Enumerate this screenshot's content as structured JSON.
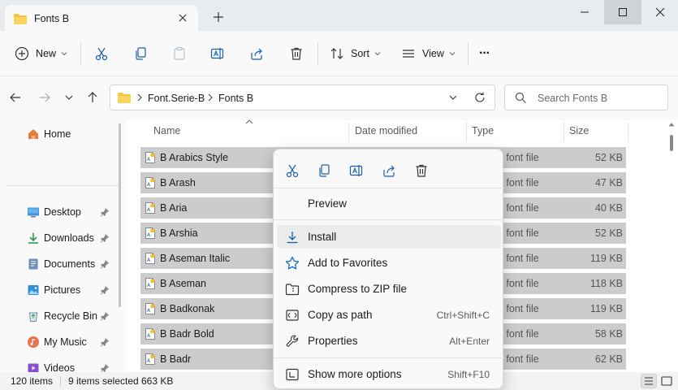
{
  "window": {
    "tab_title": "Fonts B",
    "new_tab_symbol": "+"
  },
  "toolbar": {
    "new_label": "New",
    "sort_label": "Sort",
    "view_label": "View",
    "more_label": "···"
  },
  "address": {
    "crumbs": [
      "Font.Serie-B",
      "Fonts B"
    ],
    "search_placeholder": "Search Fonts B"
  },
  "sidebar": {
    "home": "Home",
    "items": [
      "Desktop",
      "Downloads",
      "Documents",
      "Pictures",
      "Recycle Bin",
      "My Music",
      "Videos"
    ]
  },
  "columns": {
    "name": "Name",
    "date": "Date modified",
    "type": "Type",
    "size": "Size"
  },
  "files": [
    {
      "name": "B Arabics Style",
      "type": "e font file",
      "size": "52 KB"
    },
    {
      "name": "B Arash",
      "type": "e font file",
      "size": "47 KB"
    },
    {
      "name": "B Aria",
      "type": "e font file",
      "size": "40 KB"
    },
    {
      "name": "B Arshia",
      "type": "e font file",
      "size": "52 KB"
    },
    {
      "name": "B Aseman Italic",
      "type": "e font file",
      "size": "119 KB"
    },
    {
      "name": "B Aseman",
      "type": "e font file",
      "size": "118 KB"
    },
    {
      "name": "B Badkonak",
      "type": "e font file",
      "size": "119 KB"
    },
    {
      "name": "B Badr Bold",
      "type": "e font file",
      "size": "58 KB"
    },
    {
      "name": "B Badr",
      "type": "e font file",
      "size": "62 KB"
    }
  ],
  "status": {
    "count": "120 items",
    "selected": "9 items selected",
    "selected_size": "663 KB"
  },
  "context_menu": {
    "quick_actions": [
      "cut-icon",
      "copy-icon",
      "rename-icon",
      "share-icon",
      "delete-icon"
    ],
    "preview": "Preview",
    "install": "Install",
    "favorites": "Add to Favorites",
    "compress": "Compress to ZIP file",
    "copy_path": "Copy as path",
    "copy_path_shortcut": "Ctrl+Shift+C",
    "properties": "Properties",
    "properties_shortcut": "Alt+Enter",
    "more_options": "Show more options",
    "more_options_shortcut": "Shift+F10"
  },
  "colors": {
    "accent": "#005fb8",
    "folder": "#f7c43f",
    "selection": "#cccccc",
    "star": "#0067c0"
  }
}
